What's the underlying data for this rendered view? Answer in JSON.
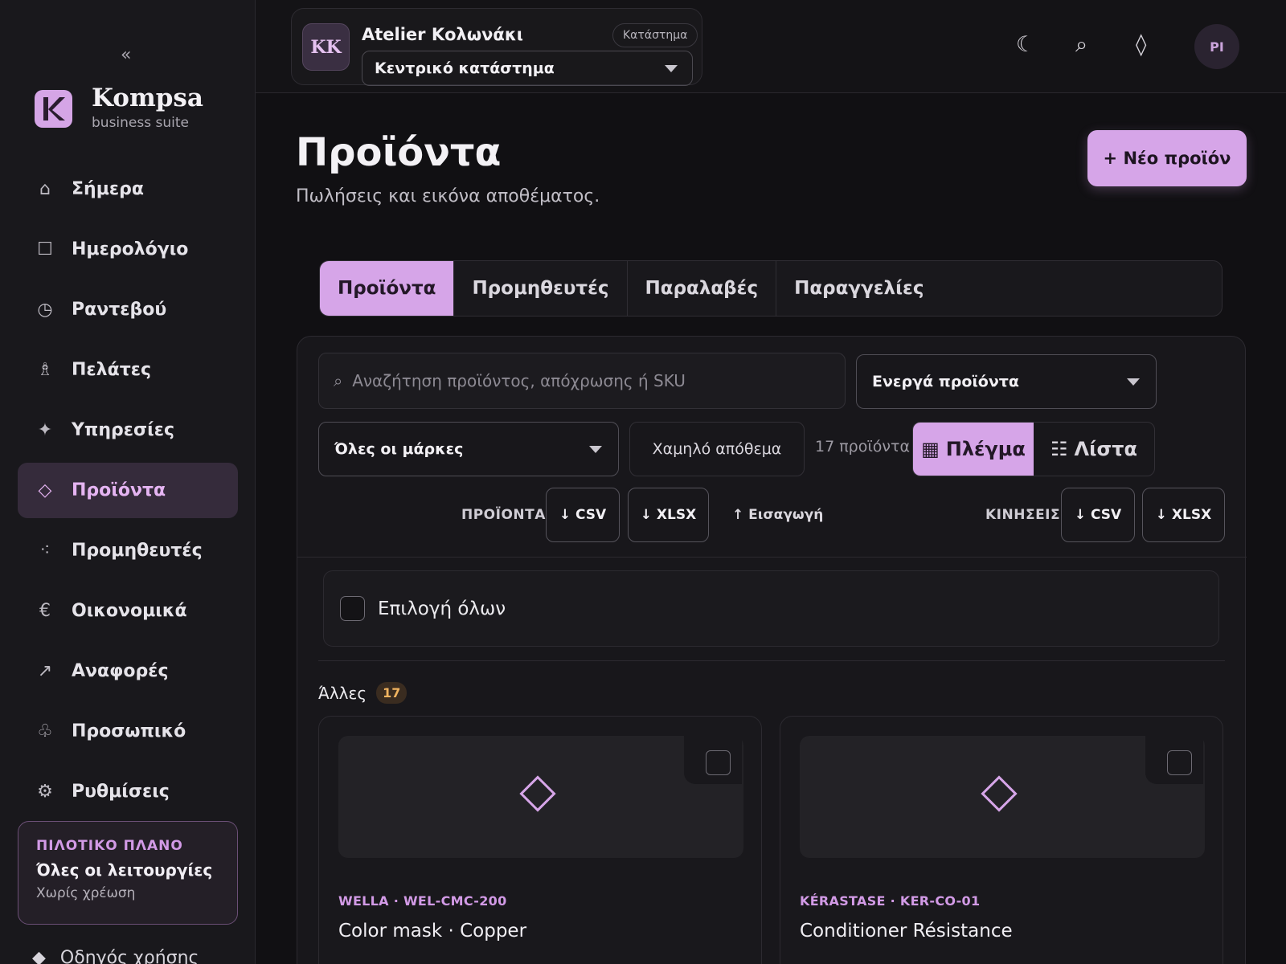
{
  "sidebar": {
    "collapse_icon": "«",
    "brand": "Kompsa",
    "brand_sub": "business suite",
    "items": [
      {
        "icon": "home-icon",
        "glyph": "⌂",
        "label": "Σήμερα"
      },
      {
        "icon": "calendar-icon",
        "glyph": "☐",
        "label": "Ημερολόγιο"
      },
      {
        "icon": "clock-icon",
        "glyph": "◷",
        "label": "Ραντεβού"
      },
      {
        "icon": "person-icon",
        "glyph": "♗",
        "label": "Πελάτες"
      },
      {
        "icon": "sparkle-icon",
        "glyph": "✦",
        "label": "Υπηρεσίες"
      },
      {
        "icon": "diamond-icon",
        "glyph": "◇",
        "label": "Προϊόντα"
      },
      {
        "icon": "dots-icon",
        "glyph": "⁖",
        "label": "Προμηθευτές"
      },
      {
        "icon": "euro-icon",
        "glyph": "€",
        "label": "Οικονομικά"
      },
      {
        "icon": "arrow-up-right-icon",
        "glyph": "↗",
        "label": "Αναφορές"
      },
      {
        "icon": "staff-icon",
        "glyph": "♧",
        "label": "Προσωπικό"
      },
      {
        "icon": "gear-icon",
        "glyph": "⚙",
        "label": "Ρυθμίσεις"
      }
    ],
    "active_item": "Προϊόντα",
    "plan": {
      "tag": "ΠΙΛΟΤΙΚΟ ΠΛΑΝΟ",
      "title": "Όλες οι λειτουργίες",
      "sub": "Χωρίς χρέωση"
    },
    "guide": {
      "glyph": "◆",
      "label": "Οδηγός χρήσης"
    }
  },
  "header": {
    "store_initials": "KK",
    "store_name": "Atelier Κολωνάκι",
    "store_badge": "Κατάστημα",
    "branch_select": "Κεντρικό κατάστημα",
    "icons": {
      "theme": "☾",
      "search": "⌕",
      "diamond": "◊"
    },
    "user_initials": "PI"
  },
  "page": {
    "title": "Προϊόντα",
    "subtitle": "Πωλήσεις και εικόνα αποθέματος.",
    "new_button": "+ Νέο προϊόν"
  },
  "tabs": [
    "Προϊόντα",
    "Προμηθευτές",
    "Παραλαβές",
    "Παραγγελίες"
  ],
  "filters": {
    "search_icon": "⌕",
    "search_placeholder": "Αναζήτηση προϊόντος, απόχρωσης ή SKU",
    "status_select": "Ενεργά προϊόντα",
    "brand_select": "Όλες οι μάρκες",
    "low_stock": "Χαμηλό απόθεμα",
    "count": "17 προϊόντα",
    "view_grid": "Πλέγμα",
    "view_grid_icon": "▦",
    "view_list": "Λίστα",
    "view_list_icon": "☷"
  },
  "export": {
    "products_label": "ΠΡΟΪΟΝΤΑ",
    "products_csv": "↓ CSV",
    "products_xlsx": "↓ XLSX",
    "import": "↑ Εισαγωγή",
    "moves_label": "ΚΙΝΗΣΕΙΣ",
    "moves_csv": "↓ CSV",
    "moves_xlsx": "↓ XLSX"
  },
  "select_all": "Επιλογή όλων",
  "group": {
    "name": "Άλλες",
    "count": "17"
  },
  "products": [
    {
      "meta": "WELLA · WEL-CMC-200",
      "name": "Color mask · Copper"
    },
    {
      "meta": "KÉRASTASE · KER-CO-01",
      "name": "Conditioner Résistance"
    }
  ],
  "colors": {
    "accent": "#d6a5e8",
    "background": "#111013",
    "sidebar": "#19181c",
    "badge": "#f1b460"
  }
}
